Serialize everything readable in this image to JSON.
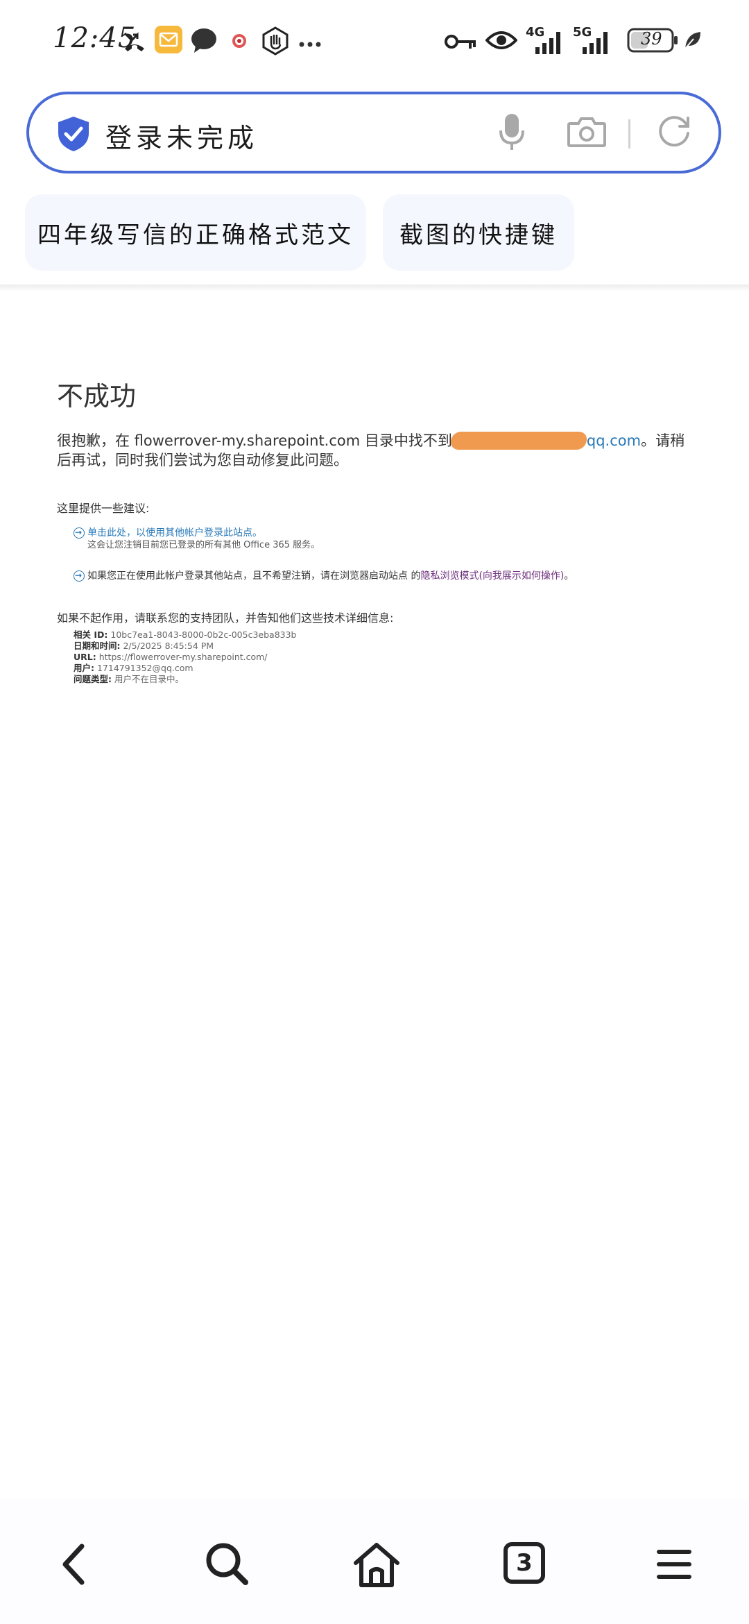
{
  "status_bar": {
    "time": "12:45",
    "network_1": "4G",
    "network_2": "5G",
    "battery": "39",
    "icons": [
      "missed-call-icon",
      "mail-app-icon",
      "chat-bubble-icon",
      "app-notification-icon",
      "hand-icon",
      "more-dots-icon",
      "key-icon",
      "eye-icon",
      "signal-icon",
      "battery-icon",
      "leaf-icon"
    ]
  },
  "search_bar": {
    "text": "登录未完成",
    "icons": [
      "shield-check-icon",
      "microphone-icon",
      "camera-icon",
      "reload-icon"
    ]
  },
  "suggestions": [
    {
      "label": "四年级写信的正确格式范文"
    },
    {
      "label": "截图的快捷键"
    }
  ],
  "page": {
    "heading": "不成功",
    "message_prefix": "很抱歉，在 flowerrover-my.sharepoint.com 目录中找不到",
    "message_link": "qq.com",
    "message_suffix": "。请稍后再试，同时我们尝试为您自动修复此问题。",
    "suggestions_title": "这里提供一些建议:",
    "suggestion_1_link": "单击此处，以使用其他帐户登录此站点。",
    "suggestion_1_sub": "这会让您注销目前您已登录的所有其他 Office 365 服务。",
    "suggestion_2_text": "如果您正在使用此帐户登录其他站点，且不希望注销，请在浏览器启动站点 的",
    "suggestion_2_link": "隐私浏览模式(向我展示如何操作)",
    "suggestion_2_end": "。",
    "help_title": "如果不起作用，请联系您的支持团队，并告知他们这些技术详细信息:",
    "details": [
      {
        "label": "相关 ID:",
        "value": "10bc7ea1-8043-8000-0b2c-005c3eba833b"
      },
      {
        "label": "日期和时间:",
        "value": "2/5/2025 8:45:54 PM"
      },
      {
        "label": "URL:",
        "value": "https://flowerrover-my.sharepoint.com/"
      },
      {
        "label": "用户:",
        "value": "1714791352@qq.com"
      },
      {
        "label": "问题类型:",
        "value": "用户不在目录中。"
      }
    ]
  },
  "bottom_nav": {
    "tab_count": "3",
    "icons": [
      "back-icon",
      "search-icon",
      "home-icon",
      "tabs-icon",
      "menu-icon"
    ]
  }
}
